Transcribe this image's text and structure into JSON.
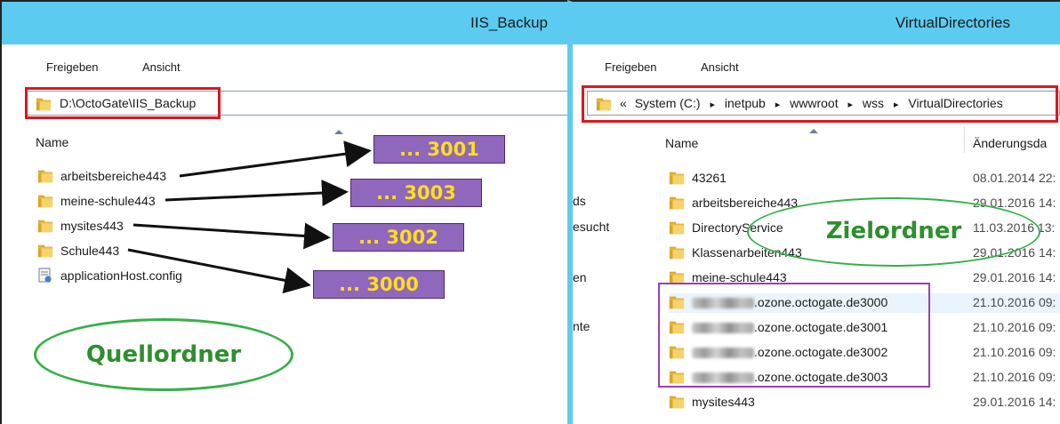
{
  "left": {
    "title": "IIS_Backup",
    "ribbon": [
      "Freigeben",
      "Ansicht"
    ],
    "address": "D:\\OctoGate\\IIS_Backup",
    "column_name": "Name",
    "files": [
      {
        "name": "arbeitsbereiche443",
        "icon": "folder-icon"
      },
      {
        "name": "meine-schule443",
        "icon": "folder-icon"
      },
      {
        "name": "mysites443",
        "icon": "folder-icon"
      },
      {
        "name": "Schule443",
        "icon": "folder-icon"
      },
      {
        "name": "applicationHost.config",
        "icon": "config-file-icon"
      }
    ],
    "annotation": "Quellordner",
    "port_labels": [
      "... 3001",
      "... 3003",
      "... 3002",
      "... 3000"
    ]
  },
  "right": {
    "title": "VirtualDirectories",
    "ribbon": [
      "Freigeben",
      "Ansicht"
    ],
    "breadcrumb": {
      "prefix": "«",
      "parts": [
        "System (C:)",
        "inetpub",
        "wwwroot",
        "wss",
        "VirtualDirectories"
      ],
      "separator": "▸"
    },
    "column_name": "Name",
    "column_date": "Änderungsda",
    "side_nav_fragments": [
      "ds",
      "esucht",
      "en",
      "nte"
    ],
    "annotation": "Zielordner",
    "files": [
      {
        "name": "43261",
        "date": "08.01.2014 22:"
      },
      {
        "name": "arbeitsbereiche443",
        "date": "29.01.2016 14:"
      },
      {
        "name": "DirectoryService",
        "date": "11.03.2016 13:"
      },
      {
        "name": "Klassenarbeiten443",
        "date": "29.01.2016 14:"
      },
      {
        "name": "meine-schule443",
        "date": "29.01.2016 14:"
      },
      {
        "name": ".ozone.octogate.de3000",
        "date": "21.10.2016 09:"
      },
      {
        "name": ".ozone.octogate.de3001",
        "date": "21.10.2016 09:"
      },
      {
        "name": ".ozone.octogate.de3002",
        "date": "21.10.2016 09:"
      },
      {
        "name": ".ozone.octogate.de3003",
        "date": "21.10.2016 09:"
      },
      {
        "name": "mysites443",
        "date": "29.01.2016 14:"
      }
    ]
  },
  "colors": {
    "titlebar": "#5ccbf0",
    "highlight_red": "#e0141c",
    "highlight_purple": "#9b3fb5",
    "label_bg": "#8f67bd",
    "label_text": "#ffdf1a",
    "ellipse_green": "#35b049"
  }
}
